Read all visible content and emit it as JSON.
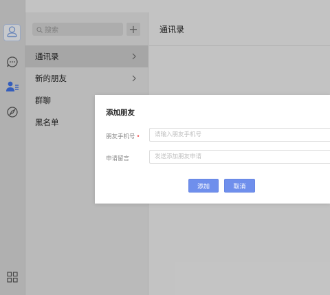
{
  "search": {
    "placeholder": "搜索",
    "add_label": "+"
  },
  "menu": [
    {
      "label": "通讯录",
      "has_chevron": true,
      "active": true
    },
    {
      "label": "新的朋友",
      "has_chevron": true,
      "active": false
    },
    {
      "label": "群聊",
      "has_chevron": false,
      "active": false
    },
    {
      "label": "黑名单",
      "has_chevron": false,
      "active": false
    }
  ],
  "main": {
    "title": "通讯录"
  },
  "dialog": {
    "title": "添加朋友",
    "phone_label": "朋友手机号",
    "required_mark": "•",
    "phone_placeholder": "请输入朋友手机号",
    "message_label": "申请留言",
    "message_placeholder": "发送添加朋友申请",
    "ok_label": "添加",
    "cancel_label": "取消"
  },
  "rail_icons": [
    "user-avatar-icon",
    "chat-icon",
    "contacts-icon",
    "compass-icon",
    "apps-grid-icon"
  ],
  "colors": {
    "accent": "#6f8fec",
    "required": "#f25b5b",
    "active_icon": "#3f6fe0"
  }
}
